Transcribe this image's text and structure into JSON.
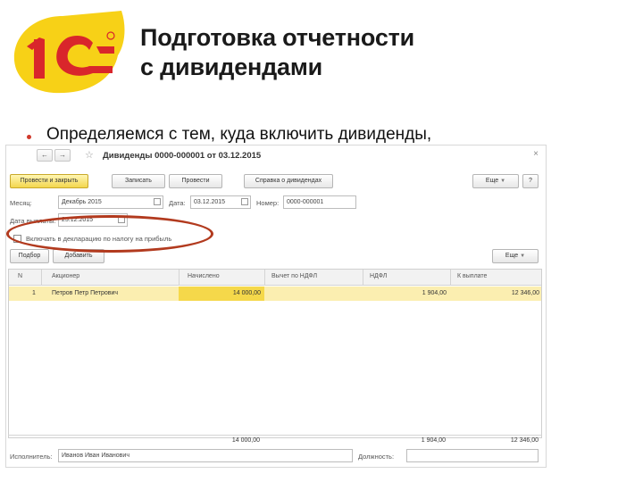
{
  "slide": {
    "title_line1": "Подготовка отчетности",
    "title_line2": "с дивидендами",
    "bullet": "Определяемся с тем, куда включить дивиденды,"
  },
  "colors": {
    "logo_yellow": "#f7d117",
    "logo_red": "#d9262b",
    "accent": "#f5d84a",
    "oval": "#b23a1e"
  },
  "window": {
    "doc_title": "Дивиденды 0000-000001 от 03.12.2015",
    "nav_back": "←",
    "nav_forward": "→",
    "star": "☆",
    "close": "×",
    "toolbar": {
      "post_close": "Провести и закрыть",
      "save": "Записать",
      "post": "Провести",
      "report": "Справка о дивидендах",
      "more": "Еще"
    },
    "fields": {
      "month_label": "Месяц:",
      "month_value": "Декабрь 2015",
      "date_label": "Дата:",
      "date_value": "03.12.2015",
      "number_label": "Номер:",
      "number_value": "0000-000001",
      "pay_date_label": "Дата выплаты:",
      "pay_date_value": "25.12.2015",
      "checkbox_label": "Включать в декларацию по налогу на прибыль"
    },
    "table_toolbar": {
      "select": "Подбор",
      "add": "Добавить",
      "more": "Еще"
    },
    "table": {
      "headers": [
        "N",
        "Акционер",
        "Начислено",
        "Вычет по НДФЛ",
        "НДФЛ",
        "К выплате"
      ],
      "rows": [
        {
          "n": "1",
          "holder": "Петров Петр Петрович",
          "accrued": "14 000,00",
          "deduction": "",
          "ndfl": "1 904,00",
          "payout": "12 346,00"
        }
      ],
      "totals": {
        "accrued": "14 000,00",
        "ndfl": "1 904,00",
        "payout": "12 346,00"
      }
    },
    "footer": {
      "executor_label": "Исполнитель:",
      "executor_value": "Иванов Иван Иванович",
      "position_label": "Должность:"
    }
  }
}
